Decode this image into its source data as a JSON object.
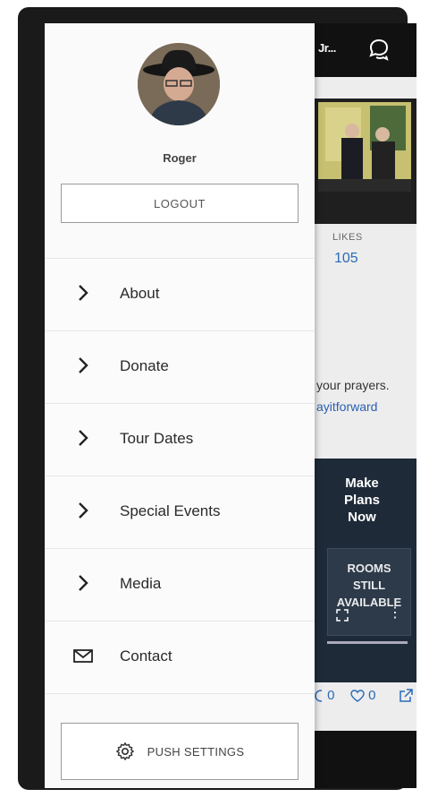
{
  "drawer": {
    "username": "Roger",
    "logout_label": "LOGOUT",
    "menu_items": [
      {
        "label": "About",
        "icon": "chevron-right-icon"
      },
      {
        "label": "Donate",
        "icon": "chevron-right-icon"
      },
      {
        "label": "Tour Dates",
        "icon": "chevron-right-icon"
      },
      {
        "label": "Special Events",
        "icon": "chevron-right-icon"
      },
      {
        "label": "Media",
        "icon": "chevron-right-icon"
      },
      {
        "label": "Contact",
        "icon": "envelope-icon"
      }
    ],
    "push_settings_label": "PUSH SETTINGS"
  },
  "background": {
    "header_name": "Jr...",
    "likes_label": "LIKES",
    "likes_count": "105",
    "post_text": "your prayers.",
    "post_link": "ayitforward",
    "promo_title": "Make Plans Now",
    "promo_subtitle": "ROOMS STILL AVAILABLE",
    "comments_count": "0",
    "hearts_count": "0"
  },
  "colors": {
    "accent": "#2a6bb8",
    "drawer_bg": "#fafafa",
    "topbar": "#111111"
  }
}
